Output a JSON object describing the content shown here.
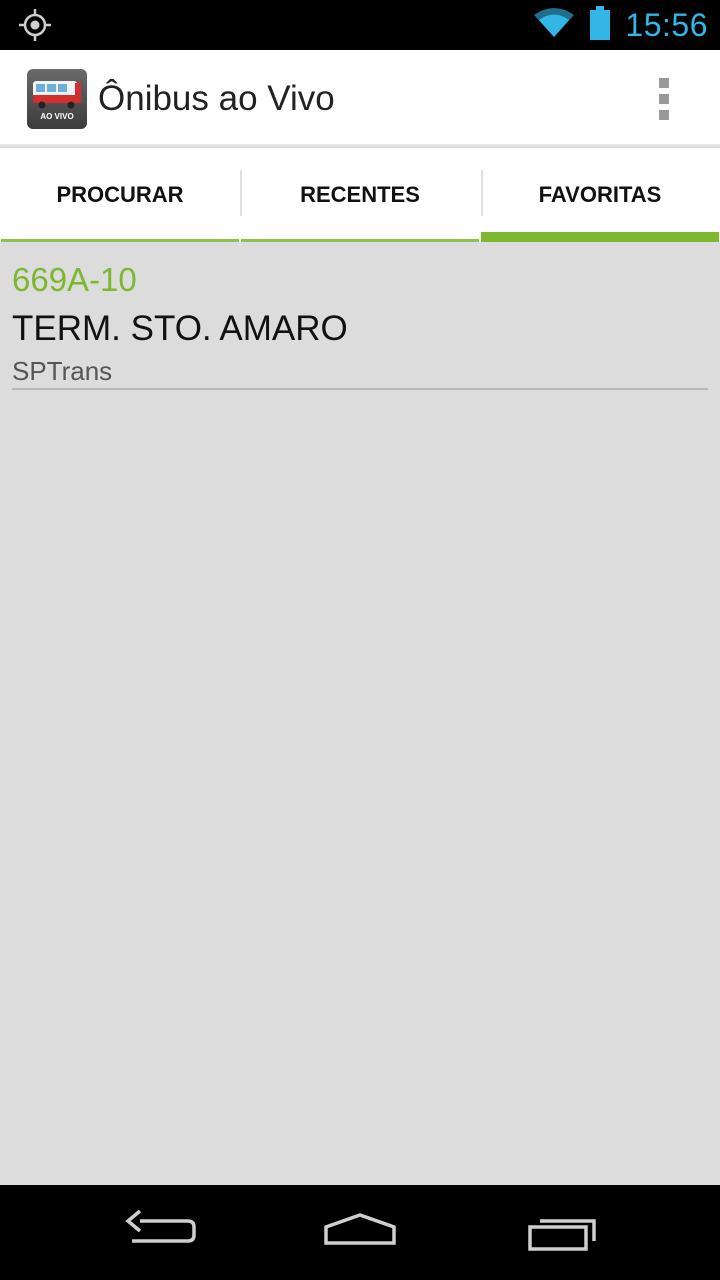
{
  "status_bar": {
    "time": "15:56",
    "accent_color": "#33b5e5",
    "icons": [
      "location-icon",
      "wifi-icon",
      "battery-icon"
    ]
  },
  "action_bar": {
    "title": "Ônibus ao Vivo",
    "app_icon_text": "AO VIVO"
  },
  "tabs": [
    {
      "label": "PROCURAR",
      "selected": false
    },
    {
      "label": "RECENTES",
      "selected": false
    },
    {
      "label": "FAVORITAS",
      "selected": true
    }
  ],
  "accent_color": "#7cb82f",
  "favorites": [
    {
      "code": "669A-10",
      "name": "TERM. STO. AMARO",
      "operator": "SPTrans"
    }
  ],
  "nav_bar": {
    "buttons": [
      "back-button",
      "home-button",
      "recent-apps-button"
    ]
  }
}
